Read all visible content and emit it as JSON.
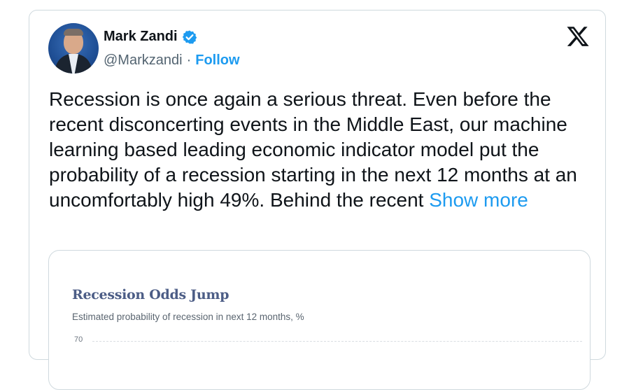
{
  "author": {
    "name": "Mark Zandi",
    "handle": "@Markzandi",
    "separator": "·",
    "follow_label": "Follow",
    "verified_color": "#1d9bf0"
  },
  "icons": {
    "brand": "x-logo-icon",
    "verified": "verified-badge-icon"
  },
  "tweet": {
    "text": "Recession is once again a serious threat. Even before the recent disconcerting events in the Middle East, our machine learning based leading economic indicator model put the probability of a recession starting in the next 12 months at an uncomfortably high 49%. Behind the recent ",
    "show_more_label": "Show more"
  },
  "media": {
    "chart_title": "Recession Odds Jump",
    "chart_subtitle": "Estimated probability of recession in next 12 months, %",
    "visible_y_tick": "70"
  },
  "chart_data": {
    "type": "line",
    "title": "Recession Odds Jump",
    "subtitle": "Estimated probability of recession in next 12 months, %",
    "yticks": [
      "70"
    ]
  },
  "colors": {
    "accent": "#1d9bf0",
    "text": "#0f1419",
    "secondary_text": "#536471",
    "chart_title": "#4c5d86",
    "border": "#cfd9de"
  }
}
